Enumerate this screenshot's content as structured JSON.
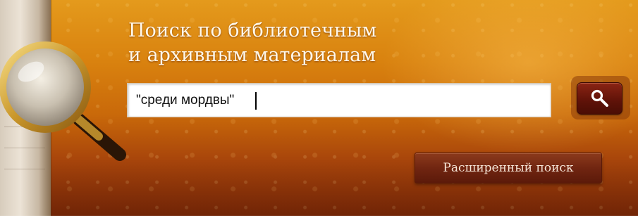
{
  "header": {
    "title_line1": "Поиск по библиотечным",
    "title_line2": "и архивным материалам"
  },
  "search": {
    "value": "\"среди мордвы\"",
    "button_icon": "search-icon"
  },
  "advanced": {
    "label": "Расширенный поиск"
  },
  "colors": {
    "banner_top": "#e49a1c",
    "banner_bottom": "#7e2a08",
    "button_dark": "#5e1208",
    "title_text": "#fff8ea"
  },
  "decor": {
    "magnifier": "magnifier-icon"
  }
}
